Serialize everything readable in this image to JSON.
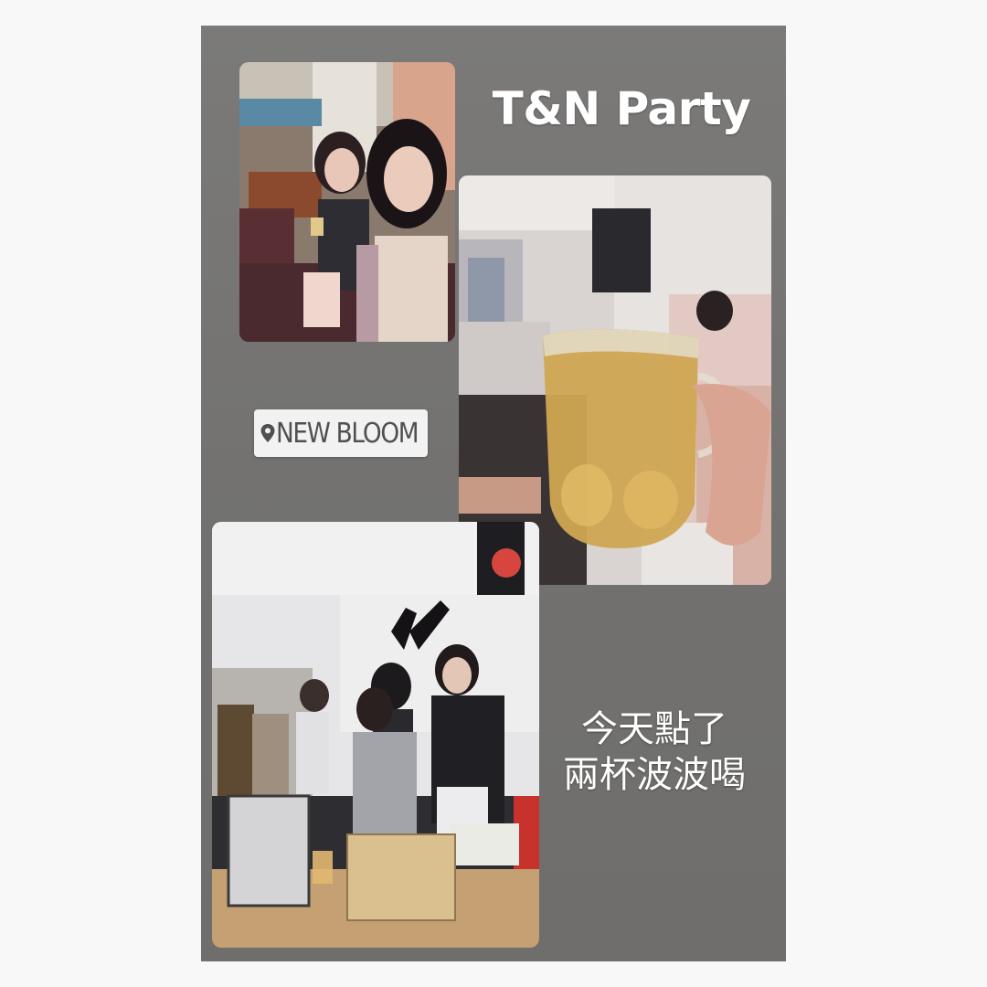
{
  "story": {
    "title": "T&N Party",
    "location": {
      "icon": "location-pin-icon",
      "label": "NEW BLOOM"
    },
    "caption": {
      "line1": "今天點了",
      "line2": "兩杯波波喝"
    },
    "colors": {
      "background": "#737270",
      "text": "#ffffff",
      "sticker": "#f2f2f2",
      "sticker_text": "#505050"
    }
  }
}
